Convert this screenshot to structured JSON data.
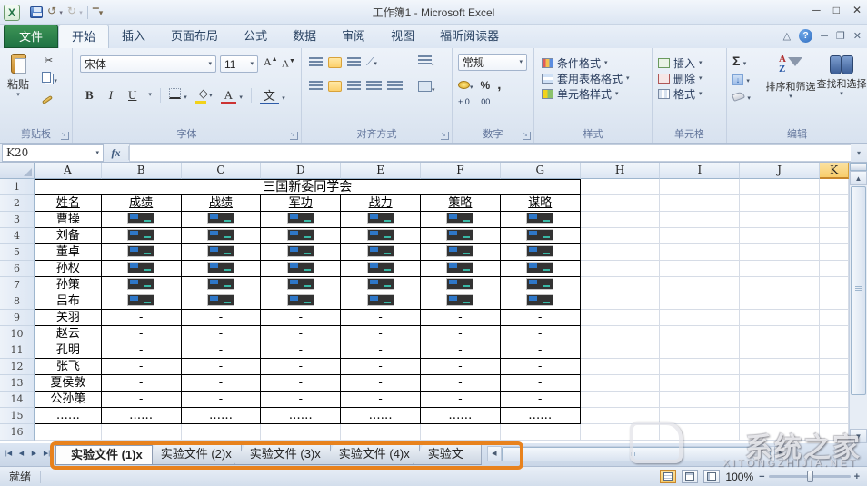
{
  "window": {
    "title": "工作簿1 - Microsoft Excel"
  },
  "ribbon": {
    "file_tab": "文件",
    "tabs": [
      "开始",
      "插入",
      "页面布局",
      "公式",
      "数据",
      "审阅",
      "视图",
      "福昕阅读器"
    ],
    "active_tab": "开始",
    "clipboard": {
      "paste": "粘贴",
      "label": "剪贴板"
    },
    "font": {
      "name": "宋体",
      "size": "11",
      "bold": "B",
      "italic": "I",
      "underline": "U",
      "pinyin": "文",
      "label": "字体"
    },
    "alignment": {
      "label": "对齐方式"
    },
    "number": {
      "format": "常规",
      "percent": "%",
      "comma": ",",
      "dec_inc": "+.0",
      "dec_dec": ".00",
      "label": "数字"
    },
    "styles": {
      "items": [
        "条件格式",
        "套用表格格式",
        "单元格样式"
      ],
      "label": "样式"
    },
    "cells": {
      "items": [
        "插入",
        "删除",
        "格式"
      ],
      "label": "单元格"
    },
    "editing": {
      "sigma": "Σ",
      "sort": "排序和筛选",
      "find": "查找和选择",
      "label": "编辑"
    }
  },
  "formula_bar": {
    "name_box": "K20",
    "fx": "fx"
  },
  "grid": {
    "columns": [
      "A",
      "B",
      "C",
      "D",
      "E",
      "F",
      "G",
      "H",
      "I",
      "J",
      "K"
    ],
    "selected_column": "K",
    "row_count": 16,
    "title": "三国新委同学会",
    "headers": [
      "姓名",
      "成绩",
      "战绩",
      "军功",
      "战力",
      "策略",
      "谋略"
    ],
    "dash": "-",
    "ellipsis": "……",
    "rows": [
      {
        "name": "曹操",
        "cells": "img"
      },
      {
        "name": "刘备",
        "cells": "img"
      },
      {
        "name": "董卓",
        "cells": "img"
      },
      {
        "name": "孙权",
        "cells": "img"
      },
      {
        "name": "孙策",
        "cells": "img"
      },
      {
        "name": "吕布",
        "cells": "img"
      },
      {
        "name": "关羽",
        "cells": "dash"
      },
      {
        "name": "赵云",
        "cells": "dash"
      },
      {
        "name": "孔明",
        "cells": "dash"
      },
      {
        "name": "张飞",
        "cells": "dash"
      },
      {
        "name": "夏侯敦",
        "cells": "dash"
      },
      {
        "name": "公孙策",
        "cells": "dash"
      },
      {
        "name": "……",
        "cells": "ellipsis"
      }
    ]
  },
  "sheet_tabs": {
    "tabs": [
      "实验文件 (1)x",
      "实验文件 (2)x",
      "实验文件 (3)x",
      "实验文件 (4)x",
      "实验文件"
    ],
    "active": "实验文件 (1)x"
  },
  "status_bar": {
    "ready": "就绪",
    "zoom": "100%"
  },
  "watermark": {
    "text": "系统之家",
    "subtext": "XITONGZHIJIA.NET"
  }
}
